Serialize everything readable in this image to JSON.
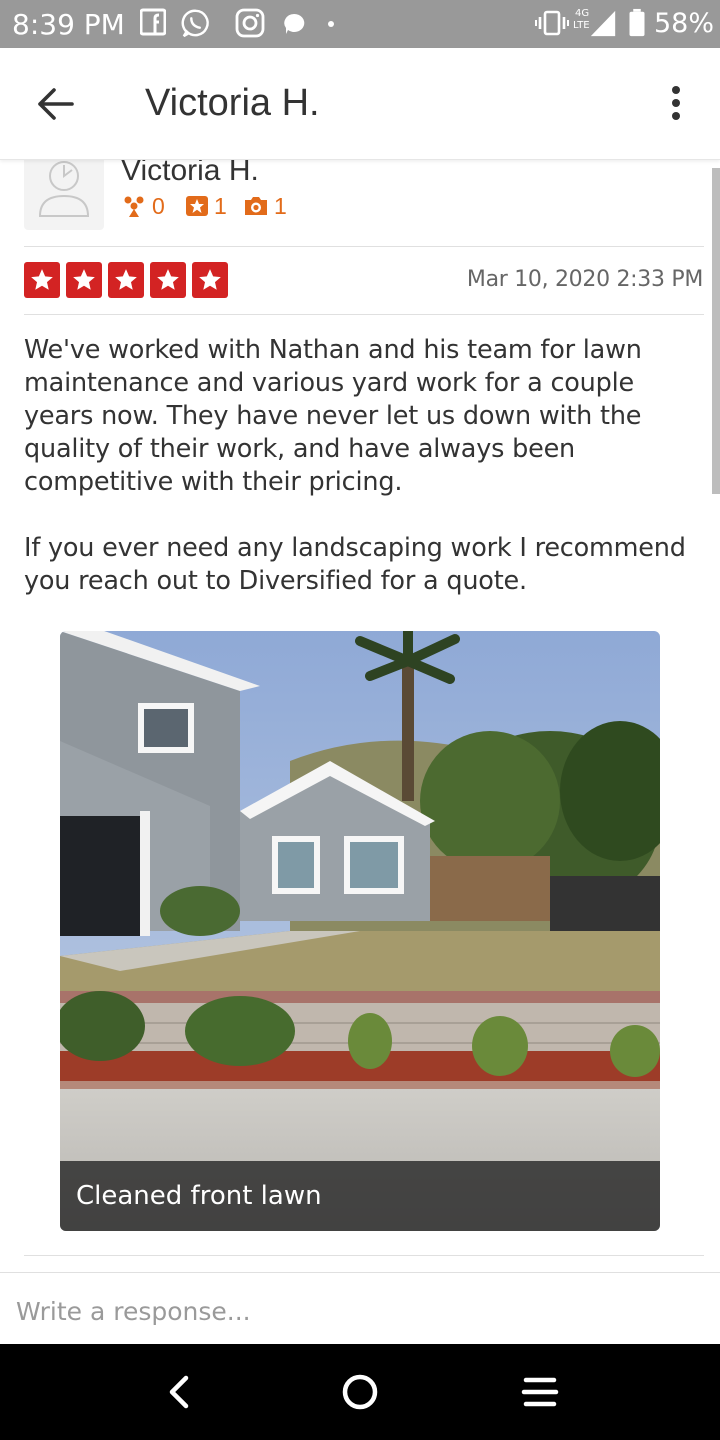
{
  "status_bar": {
    "time": "8:39 PM",
    "network": "4G",
    "network_sub": "LTE",
    "battery": "58%",
    "icons": [
      "facebook-icon",
      "whatsapp-icon",
      "instagram-icon",
      "messenger-icon",
      "dot-icon",
      "vibrate-icon",
      "signal-icon",
      "battery-icon"
    ]
  },
  "app_bar": {
    "title": "Victoria H.",
    "back_icon": "arrow-left-icon",
    "menu_icon": "more-vertical-icon"
  },
  "user": {
    "name": "Victoria H.",
    "friends_count": "0",
    "reviews_count": "1",
    "photos_count": "1"
  },
  "review": {
    "rating": 5,
    "rating_max": 5,
    "date": "Mar 10, 2020 2:33 PM",
    "paragraphs": [
      "We've worked with Nathan and his team for lawn maintenance and various yard work for a couple years now. They have never let us down with the quality of their work, and have always been competitive with their pricing.",
      "If you ever need any landscaping work I recommend you reach out to Diversified for a quote."
    ],
    "photo_caption": "Cleaned front lawn"
  },
  "response": {
    "placeholder": "Write a response..."
  },
  "colors": {
    "star_red": "#d32323",
    "stat_orange": "#e26b1a",
    "status_bar": "#999999"
  }
}
